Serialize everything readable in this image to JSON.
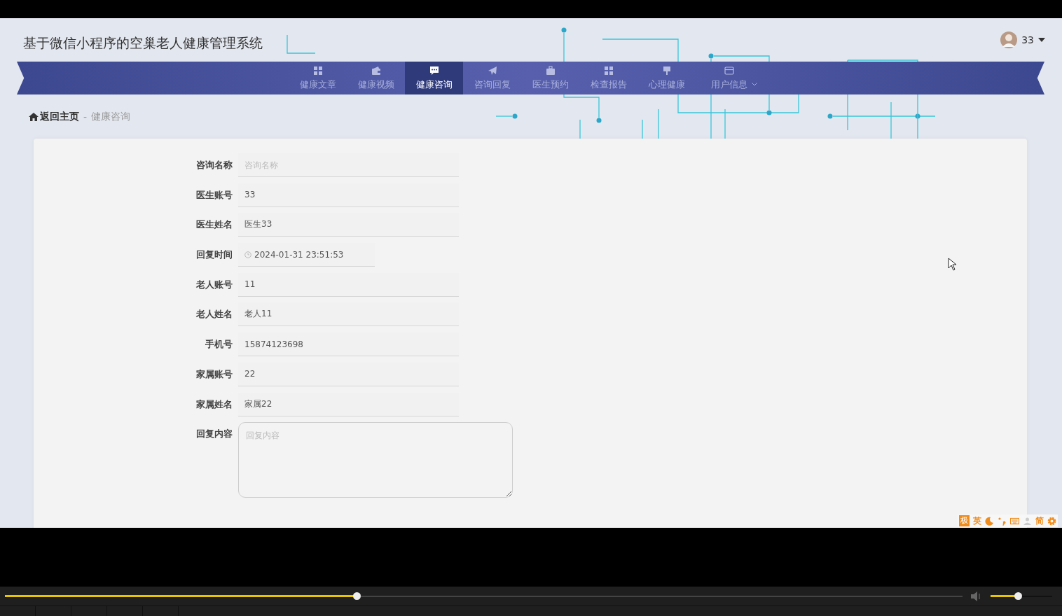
{
  "header": {
    "title": "基于微信小程序的空巢老人健康管理系统",
    "user": "33"
  },
  "nav": [
    {
      "label": "健康文章",
      "selected": false
    },
    {
      "label": "健康视频",
      "selected": false
    },
    {
      "label": "健康咨询",
      "selected": true
    },
    {
      "label": "咨询回复",
      "selected": false
    },
    {
      "label": "医生预约",
      "selected": false
    },
    {
      "label": "检查报告",
      "selected": false
    },
    {
      "label": "心理健康",
      "selected": false
    },
    {
      "label": "用户信息",
      "selected": false,
      "dropdown": true
    }
  ],
  "breadcrumb": {
    "home": "返回主页",
    "separator": "-",
    "current": "健康咨询"
  },
  "form": {
    "fields": [
      {
        "label": "咨询名称",
        "kind": "text",
        "placeholder": "咨询名称"
      },
      {
        "label": "医生账号",
        "kind": "text",
        "value": "33"
      },
      {
        "label": "医生姓名",
        "kind": "text",
        "value": "医生33"
      },
      {
        "label": "回复时间",
        "kind": "datetime",
        "value": "2024-01-31 23:51:53"
      },
      {
        "label": "老人账号",
        "kind": "text",
        "value": "11"
      },
      {
        "label": "老人姓名",
        "kind": "text",
        "value": "老人11"
      },
      {
        "label": "手机号",
        "kind": "text",
        "value": "15874123698"
      },
      {
        "label": "家属账号",
        "kind": "text",
        "value": "22"
      },
      {
        "label": "家属姓名",
        "kind": "text",
        "value": "家属22"
      },
      {
        "label": "回复内容",
        "kind": "textarea",
        "placeholder": "回复内容"
      }
    ]
  },
  "ime_toolbar": [
    {
      "kind": "badge",
      "label": "极"
    },
    {
      "kind": "text",
      "label": "英"
    },
    {
      "kind": "moon"
    },
    {
      "kind": "punct"
    },
    {
      "kind": "keyboard"
    },
    {
      "kind": "person"
    },
    {
      "kind": "text",
      "label": "简"
    },
    {
      "kind": "gear"
    }
  ],
  "player": {
    "seek": {
      "level": 0.367
    },
    "volume": {
      "level": 0.44
    }
  }
}
